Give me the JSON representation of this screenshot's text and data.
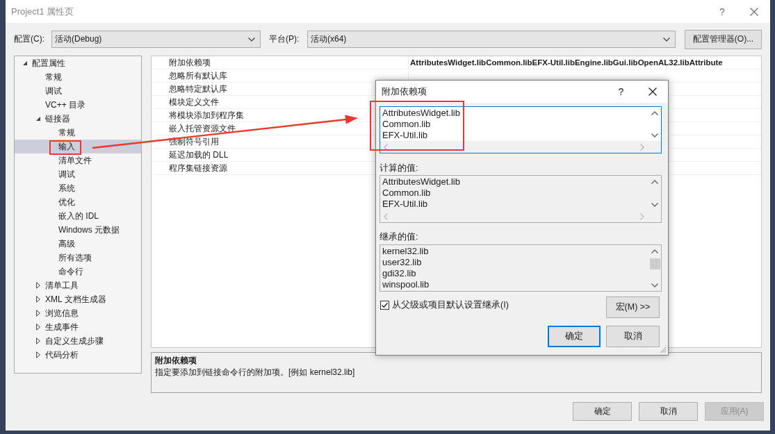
{
  "window": {
    "title": "Project1 属性页",
    "help_button": "?"
  },
  "config_bar": {
    "configuration_label": "配置(C):",
    "configuration_value": "活动(Debug)",
    "platform_label": "平台(P):",
    "platform_value": "活动(x64)",
    "manager_button": "配置管理器(O)..."
  },
  "tree": [
    {
      "label": "配置属性",
      "expanded": true,
      "selected": false,
      "children": [
        {
          "label": "常规",
          "selected": false
        },
        {
          "label": "调试",
          "selected": false
        },
        {
          "label": "VC++ 目录",
          "selected": false
        },
        {
          "label": "链接器",
          "expanded": true,
          "selected": false,
          "children": [
            {
              "label": "常规",
              "selected": false
            },
            {
              "label": "输入",
              "selected": true
            },
            {
              "label": "清单文件",
              "selected": false
            },
            {
              "label": "调试",
              "selected": false
            },
            {
              "label": "系统",
              "selected": false
            },
            {
              "label": "优化",
              "selected": false
            },
            {
              "label": "嵌入的 IDL",
              "selected": false
            },
            {
              "label": "Windows 元数据",
              "selected": false
            },
            {
              "label": "高级",
              "selected": false
            },
            {
              "label": "所有选项",
              "selected": false
            },
            {
              "label": "命令行",
              "selected": false
            }
          ]
        },
        {
          "label": "清单工具",
          "expanded": false,
          "selected": false
        },
        {
          "label": "XML 文档生成器",
          "expanded": false,
          "selected": false
        },
        {
          "label": "浏览信息",
          "expanded": false,
          "selected": false
        },
        {
          "label": "生成事件",
          "expanded": false,
          "selected": false
        },
        {
          "label": "自定义生成步骤",
          "expanded": false,
          "selected": false
        },
        {
          "label": "代码分析",
          "expanded": false,
          "selected": false
        }
      ]
    }
  ],
  "properties": [
    {
      "name": "附加依赖项",
      "value": "AttributesWidget.libCommon.libEFX-Util.libEngine.libGui.libOpenAL32.libAttribute"
    },
    {
      "name": "忽略所有默认库"
    },
    {
      "name": "忽略特定默认库"
    },
    {
      "name": "模块定义文件"
    },
    {
      "name": "将模块添加到程序集"
    },
    {
      "name": "嵌入托管资源文件"
    },
    {
      "name": "强制符号引用"
    },
    {
      "name": "延迟加载的 DLL"
    },
    {
      "name": "程序集链接资源"
    }
  ],
  "description": {
    "title": "附加依赖项",
    "text": "指定要添加到链接命令行的附加项。[例如 kernel32.lib]"
  },
  "buttons": [
    {
      "label": "确定",
      "disabled": false
    },
    {
      "label": "取消",
      "disabled": false
    },
    {
      "label": "应用(A)",
      "disabled": true
    }
  ],
  "dialog": {
    "title": "附加依赖项",
    "help_button": "?",
    "edit_lines": [
      "AttributesWidget.lib",
      "Common.lib",
      "EFX-Util.lib"
    ],
    "evaluated_label": "计算的值:",
    "evaluated_lines": [
      "AttributesWidget.lib",
      "Common.lib",
      "EFX-Util.lib"
    ],
    "inherited_label": "继承的值:",
    "inherited_lines": [
      "kernel32.lib",
      "user32.lib",
      "gdi32.lib",
      "winspool.lib"
    ],
    "inherit_checkbox": {
      "label": "从父级或项目默认设置继承(I)",
      "checked": true
    },
    "macro_button": "宏(M) >>",
    "buttons": [
      {
        "label": "确定",
        "default": true
      },
      {
        "label": "取消",
        "default": false
      }
    ]
  }
}
